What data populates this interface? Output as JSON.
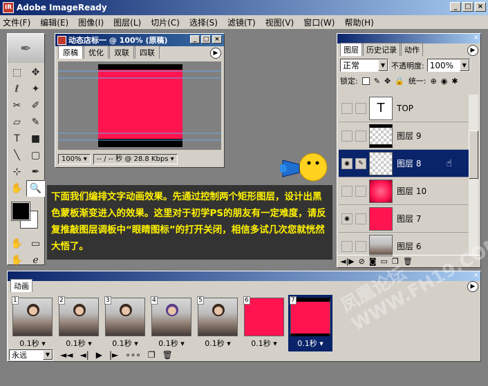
{
  "app": {
    "title": "Adobe ImageReady"
  },
  "menu": [
    "文件(F)",
    "编辑(E)",
    "图像(I)",
    "图层(L)",
    "切片(C)",
    "选择(S)",
    "滤镜(T)",
    "视图(V)",
    "窗口(W)",
    "帮助(H)"
  ],
  "document": {
    "title": "动态店标一 @ 100% (原稿)",
    "tabs": [
      "原稿",
      "优化",
      "双联",
      "四联"
    ],
    "zoom": "100%",
    "status": "-- / -- 秒 @ 28.8 Kbps"
  },
  "tip": {
    "text": "下面我们编排文字动画效果。先通过控制两个矩形图层，设计出黑色蒙板渐变进入的效果。这里对于初学PS的朋友有一定难度，请反复推敲图层调板中“眼睛图标”的打开关闭，相信多试几次您就恍然大悟了。"
  },
  "layers_panel": {
    "tabs": [
      "图层",
      "历史记录",
      "动作"
    ],
    "blend_mode": "正常",
    "opacity_label": "不透明度:",
    "opacity": "100%",
    "lock_label": "锁定:",
    "unify_label": "统一:",
    "layers": [
      {
        "name": "TOP",
        "type": "text",
        "visible": false,
        "selected": false
      },
      {
        "name": "图层 9",
        "type": "black-bars",
        "visible": false,
        "selected": false
      },
      {
        "name": "图层 8",
        "type": "transparent",
        "visible": true,
        "selected": true
      },
      {
        "name": "图层 10",
        "type": "pink-glow",
        "visible": false,
        "selected": false
      },
      {
        "name": "图层 7",
        "type": "pink",
        "visible": true,
        "selected": false
      },
      {
        "name": "图层 6",
        "type": "photo",
        "visible": false,
        "selected": false
      }
    ]
  },
  "animation_panel": {
    "tab": "动画",
    "loop": "永远",
    "frames": [
      {
        "num": "1",
        "time": "0.1秒",
        "type": "photo"
      },
      {
        "num": "2",
        "time": "0.1秒",
        "type": "photo"
      },
      {
        "num": "3",
        "time": "0.1秒",
        "type": "photo"
      },
      {
        "num": "4",
        "time": "0.1秒",
        "type": "photo"
      },
      {
        "num": "5",
        "time": "0.1秒",
        "type": "photo"
      },
      {
        "num": "6",
        "time": "0.1秒",
        "type": "pink"
      },
      {
        "num": "7",
        "time": "0.1秒",
        "type": "pink-bars",
        "selected": true
      }
    ]
  },
  "watermark": {
    "text": "凤凰论坛 WWW.FH19.COM"
  },
  "colors": {
    "accent": "#0a246a",
    "pink": "#ff1450",
    "tip_text": "#fff200"
  }
}
